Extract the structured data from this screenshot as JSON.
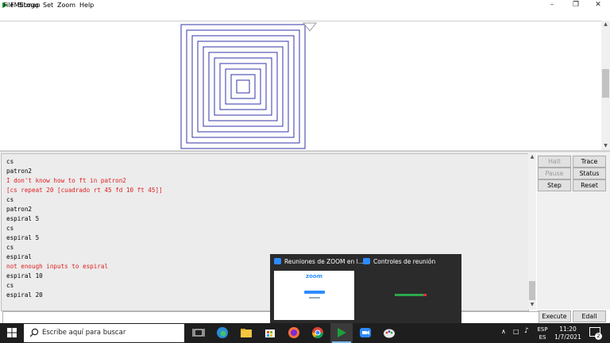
{
  "window": {
    "title": "FMSLogo"
  },
  "menu": [
    {
      "label": "File"
    },
    {
      "label": "Bitmap"
    },
    {
      "label": "Set"
    },
    {
      "label": "Zoom"
    },
    {
      "label": "Help"
    }
  ],
  "history": [
    {
      "text": "cs",
      "error": false
    },
    {
      "text": "patron2",
      "error": false
    },
    {
      "text": "I don't know how to ft in patron2",
      "error": true
    },
    {
      "text": "[cs repeat 20 [cuadrado rt 45 fd 10 ft 45]]",
      "error": true
    },
    {
      "text": "cs",
      "error": false
    },
    {
      "text": "patron2",
      "error": false
    },
    {
      "text": "espiral 5",
      "error": false
    },
    {
      "text": "cs",
      "error": false
    },
    {
      "text": "espiral 5",
      "error": false
    },
    {
      "text": "cs",
      "error": false
    },
    {
      "text": "espiral",
      "error": false
    },
    {
      "text": "not enough inputs to espiral",
      "error": true
    },
    {
      "text": "espiral 10",
      "error": false
    },
    {
      "text": "cs",
      "error": false
    },
    {
      "text": "espiral 20",
      "error": false
    }
  ],
  "buttons": {
    "halt": "Halt",
    "trace": "Trace",
    "pause": "Pause",
    "status": "Status",
    "step": "Step",
    "reset": "Reset",
    "execute": "Execute",
    "edall": "Edall"
  },
  "input": {
    "value": ""
  },
  "taskbar": {
    "search_placeholder": "Escribe aquí para buscar",
    "lang_top": "ESP",
    "lang_bottom": "ES",
    "time": "11:20",
    "date": "1/7/2021",
    "notifications": "2"
  },
  "popup": {
    "item1_title": "Reuniones de ZOOM en l...",
    "item2_title": "Controles de reunión",
    "zoom_logo": "zoom"
  },
  "drawing": {
    "spiral_color": "#3333aa",
    "squares": 11
  }
}
